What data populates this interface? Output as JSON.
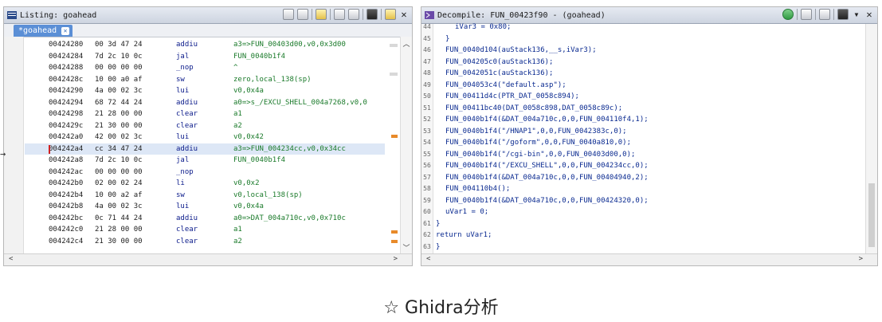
{
  "listing": {
    "title": "Listing: goahead",
    "tab_label": "*goahead",
    "rows": [
      {
        "addr": "00424280",
        "bytes": "00 3d 47 24",
        "mnemonic": "addiu",
        "operands": "a3=>FUN_00403d00,v0,0x3d00"
      },
      {
        "addr": "00424284",
        "bytes": "7d 2c 10 0c",
        "mnemonic": "jal",
        "operands": "FUN_0040b1f4"
      },
      {
        "addr": "00424288",
        "bytes": "00 00 00 00",
        "mnemonic": "_nop",
        "operands": "^"
      },
      {
        "addr": "0042428c",
        "bytes": "10 00 a0 af",
        "mnemonic": "sw",
        "operands": "zero,local_138(sp)"
      },
      {
        "addr": "00424290",
        "bytes": "4a 00 02 3c",
        "mnemonic": "lui",
        "operands": "v0,0x4a"
      },
      {
        "addr": "00424294",
        "bytes": "68 72 44 24",
        "mnemonic": "addiu",
        "operands": "a0=>s_/EXCU_SHELL_004a7268,v0,0"
      },
      {
        "addr": "00424298",
        "bytes": "21 28 00 00",
        "mnemonic": "clear",
        "operands": "a1"
      },
      {
        "addr": "0042429c",
        "bytes": "21 30 00 00",
        "mnemonic": "clear",
        "operands": "a2"
      },
      {
        "addr": "004242a0",
        "bytes": "42 00 02 3c",
        "mnemonic": "lui",
        "operands": "v0,0x42"
      },
      {
        "addr": "004242a4",
        "bytes": "cc 34 47 24",
        "mnemonic": "addiu",
        "operands": "a3=>FUN_004234cc,v0,0x34cc"
      },
      {
        "addr": "004242a8",
        "bytes": "7d 2c 10 0c",
        "mnemonic": "jal",
        "operands": "FUN_0040b1f4"
      },
      {
        "addr": "004242ac",
        "bytes": "00 00 00 00",
        "mnemonic": "_nop",
        "operands": ""
      },
      {
        "addr": "004242b0",
        "bytes": "02 00 02 24",
        "mnemonic": "li",
        "operands": "v0,0x2"
      },
      {
        "addr": "004242b4",
        "bytes": "10 00 a2 af",
        "mnemonic": "sw",
        "operands": "v0,local_138(sp)"
      },
      {
        "addr": "004242b8",
        "bytes": "4a 00 02 3c",
        "mnemonic": "lui",
        "operands": "v0,0x4a"
      },
      {
        "addr": "004242bc",
        "bytes": "0c 71 44 24",
        "mnemonic": "addiu",
        "operands": "a0=>DAT_004a710c,v0,0x710c"
      },
      {
        "addr": "004242c0",
        "bytes": "21 28 00 00",
        "mnemonic": "clear",
        "operands": "a1"
      },
      {
        "addr": "004242c4",
        "bytes": "21 30 00 00",
        "mnemonic": "clear",
        "operands": "a2"
      }
    ]
  },
  "decompile": {
    "title": "Decompile: FUN_00423f90 -  (goahead)",
    "lines": [
      {
        "ln": "44",
        "code": "      iVar3 = 0x80;",
        "indent": 2
      },
      {
        "ln": "45",
        "code": "    }",
        "indent": 1
      },
      {
        "ln": "46",
        "code": "    FUN_0040d104(auStack136,__s,iVar3);",
        "indent": 1
      },
      {
        "ln": "47",
        "code": "    FUN_004205c0(auStack136);",
        "indent": 1
      },
      {
        "ln": "48",
        "code": "    FUN_0042051c(auStack136);",
        "indent": 1
      },
      {
        "ln": "49",
        "code": "    FUN_004053c4(\"default.asp\");",
        "indent": 1
      },
      {
        "ln": "50",
        "code": "    FUN_00411d4c(PTR_DAT_0058c894);",
        "indent": 1
      },
      {
        "ln": "51",
        "code": "    FUN_00411bc40(DAT_0058c898,DAT_0058c89c);",
        "indent": 1
      },
      {
        "ln": "52",
        "code": "    FUN_0040b1f4(&DAT_004a710c,0,0,FUN_004110f4,1);",
        "indent": 1
      },
      {
        "ln": "53",
        "code": "    FUN_0040b1f4(\"/HNAP1\",0,0,FUN_0042383c,0);",
        "indent": 1
      },
      {
        "ln": "54",
        "code": "    FUN_0040b1f4(\"/goform\",0,0,FUN_0040a810,0);",
        "indent": 1
      },
      {
        "ln": "55",
        "code": "    FUN_0040b1f4(\"/cgi-bin\",0,0,FUN_00403d00,0);",
        "indent": 1
      },
      {
        "ln": "56",
        "code": "    FUN_0040b1f4(\"/EXCU_SHELL\",0,0,FUN_004234cc,0);",
        "indent": 1
      },
      {
        "ln": "57",
        "code": "    FUN_0040b1f4(&DAT_004a710c,0,0,FUN_00404940,2);",
        "indent": 1
      },
      {
        "ln": "58",
        "code": "    FUN_004110b4();",
        "indent": 1
      },
      {
        "ln": "59",
        "code": "    FUN_0040b1f4(&DAT_004a710c,0,0,FUN_00424320,0);",
        "indent": 1
      },
      {
        "ln": "60",
        "code": "    uVar1 = 0;",
        "indent": 1
      },
      {
        "ln": "61",
        "code": "  }",
        "indent": 0
      },
      {
        "ln": "62",
        "code": "  return uVar1;",
        "indent": 0
      },
      {
        "ln": "63",
        "code": "}",
        "indent": 0
      }
    ]
  },
  "caption": "☆ Ghidra分析",
  "colors": {
    "titlebar": "#cdd4e0",
    "tab": "#5b8fd6",
    "mnemonic": "#0a1a8a",
    "operand": "#1a7a2a",
    "code": "#0a2a90"
  }
}
